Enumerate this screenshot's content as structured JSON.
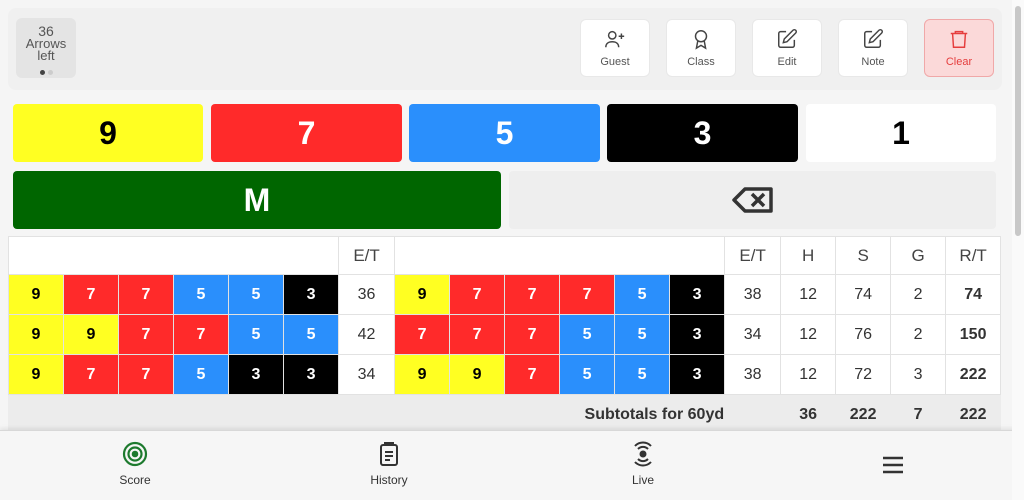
{
  "arrows": {
    "count": "36",
    "label_line1": "Arrows",
    "label_line2": "left"
  },
  "toolbar": {
    "guest": "Guest",
    "class": "Class",
    "edit": "Edit",
    "note": "Note",
    "clear": "Clear"
  },
  "score_buttons": {
    "b9": "9",
    "b7": "7",
    "b5": "5",
    "b3": "3",
    "b1": "1",
    "miss": "M"
  },
  "table": {
    "headers": {
      "et": "E/T",
      "h": "H",
      "s": "S",
      "g": "G",
      "rt": "R/T"
    },
    "rows": [
      {
        "left": [
          "9",
          "7",
          "7",
          "5",
          "5",
          "3"
        ],
        "et1": "36",
        "right": [
          "9",
          "7",
          "7",
          "7",
          "5",
          "3"
        ],
        "et2": "38",
        "h": "12",
        "s": "74",
        "g": "2",
        "rt": "74"
      },
      {
        "left": [
          "9",
          "9",
          "7",
          "7",
          "5",
          "5"
        ],
        "et1": "42",
        "right": [
          "7",
          "7",
          "7",
          "5",
          "5",
          "3"
        ],
        "et2": "34",
        "h": "12",
        "s": "76",
        "g": "2",
        "rt": "150"
      },
      {
        "left": [
          "9",
          "7",
          "7",
          "5",
          "3",
          "3"
        ],
        "et1": "34",
        "right": [
          "9",
          "9",
          "7",
          "5",
          "5",
          "3"
        ],
        "et2": "38",
        "h": "12",
        "s": "72",
        "g": "3",
        "rt": "222"
      }
    ],
    "subtotal": {
      "label": "Subtotals for 60yd",
      "h": "36",
      "s": "222",
      "g": "7",
      "rt": "222"
    }
  },
  "nav": {
    "score": "Score",
    "history": "History",
    "live": "Live"
  },
  "colors": {
    "gold": "#ffff22",
    "red": "#ff2a2a",
    "blue": "#2a8ffc",
    "black": "#000000",
    "white": "#ffffff",
    "miss_green": "#006600",
    "clear_red": "#e53e3e"
  }
}
